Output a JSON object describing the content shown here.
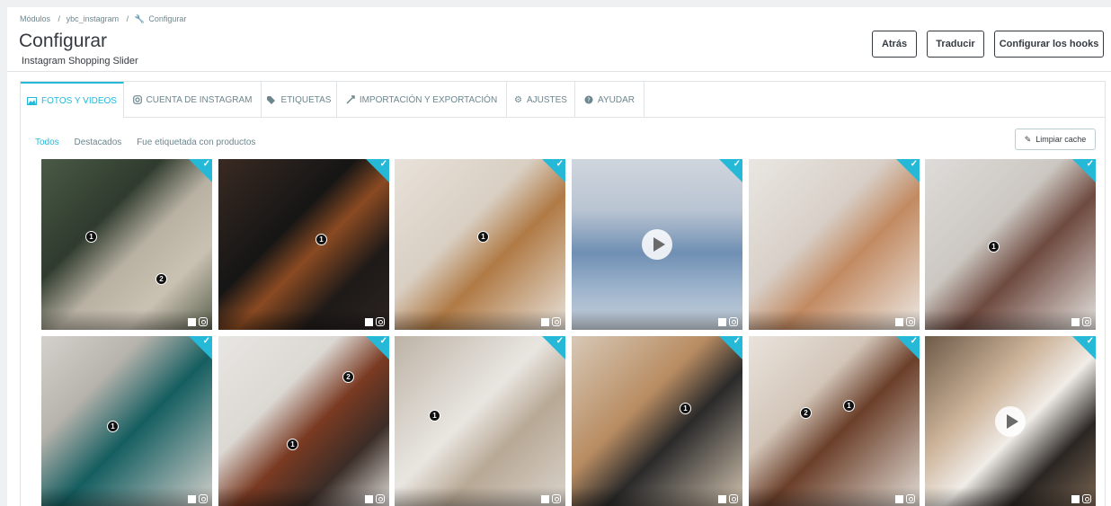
{
  "breadcrumb": {
    "items": [
      "Módulos",
      "ybc_instagram",
      "Configurar"
    ],
    "separator": "/"
  },
  "header": {
    "title": "Configurar",
    "subtitle": "Instagram Shopping Slider",
    "buttons": {
      "back": "Atrás",
      "translate": "Traducir",
      "hooks": "Configurar los hooks"
    }
  },
  "tabs": [
    {
      "label": "FOTOS Y VIDEOS",
      "icon": "image-icon",
      "active": true
    },
    {
      "label": "CUENTA DE INSTAGRAM",
      "icon": "instagram-icon",
      "active": false
    },
    {
      "label": "ETIQUETAS",
      "icon": "tags-icon",
      "active": false
    },
    {
      "label": "IMPORTACIÓN Y EXPORTACIÓN",
      "icon": "transfer-icon",
      "active": false
    },
    {
      "label": "AJUSTES",
      "icon": "gear-icon",
      "active": false
    },
    {
      "label": "AYUDAR",
      "icon": "help-icon",
      "active": false
    }
  ],
  "filters": {
    "all": "Todos",
    "featured": "Destacados",
    "tagged": "Fue etiquetada con productos",
    "selected": "Todos"
  },
  "cache_button": "Limpiar cache",
  "colors": {
    "accent": "#25b9d7",
    "text": "#363a41",
    "muted": "#6c868e"
  },
  "media": [
    {
      "type": "photo",
      "selected": true,
      "tags": [
        "1",
        "2"
      ]
    },
    {
      "type": "photo",
      "selected": true,
      "tags": [
        "1"
      ]
    },
    {
      "type": "photo",
      "selected": true,
      "tags": [
        "1"
      ]
    },
    {
      "type": "video",
      "selected": true,
      "tags": []
    },
    {
      "type": "photo",
      "selected": true,
      "tags": []
    },
    {
      "type": "photo",
      "selected": true,
      "tags": [
        "1"
      ]
    },
    {
      "type": "photo",
      "selected": true,
      "tags": [
        "1"
      ]
    },
    {
      "type": "photo",
      "selected": true,
      "tags": [
        "2",
        "1"
      ]
    },
    {
      "type": "photo",
      "selected": true,
      "tags": [
        "1"
      ]
    },
    {
      "type": "photo",
      "selected": true,
      "tags": [
        "1"
      ]
    },
    {
      "type": "photo",
      "selected": true,
      "tags": [
        "2",
        "1"
      ]
    },
    {
      "type": "video",
      "selected": true,
      "tags": []
    }
  ]
}
